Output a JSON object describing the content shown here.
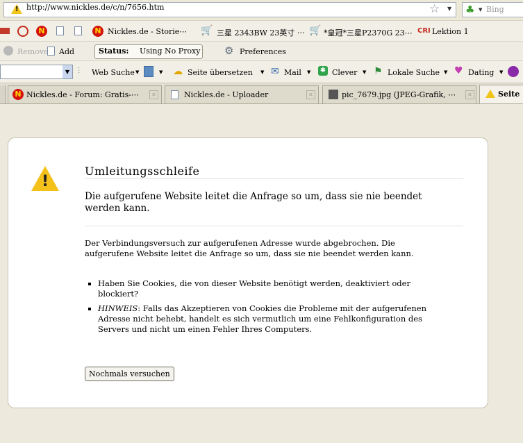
{
  "urlbar": {
    "url": "http://www.nickles.de/c/n/7656.htm",
    "search_placeholder": "Bing"
  },
  "bookmarks": [
    {
      "label": "Nickles.de - Storie⋯"
    },
    {
      "label": "三星 2343BW 23英寸 ⋯"
    },
    {
      "label": "*皇冠*三星P2370G 23⋯"
    },
    {
      "label": "Lektion 1"
    }
  ],
  "addonbar": {
    "remove": "Remove",
    "add": "Add",
    "status_label": "Status:",
    "status_value": "Using No Proxy",
    "preferences": "Preferences"
  },
  "toolbar": {
    "web_search": "Web Suche",
    "translate": "Seite übersetzen",
    "mail": "Mail",
    "clever": "Clever",
    "local_search": "Lokale Suche",
    "dating": "Dating"
  },
  "tabs": [
    {
      "label": "Nickles.de - Forum: Gratis-⋯"
    },
    {
      "label": "Nickles.de - Uploader"
    },
    {
      "label": "pic_7679.jpg (JPEG-Grafik, ⋯"
    },
    {
      "label": "Seite"
    }
  ],
  "error": {
    "title": "Umleitungsschleife",
    "short": "Die aufgerufene Website leitet die Anfrage so um, dass sie nie beendet werden kann.",
    "long": "Der Verbindungsversuch zur aufgerufenen Adresse wurde abgebrochen. Die aufgerufene Website leitet die Anfrage so um, dass sie nie beendet werden kann.",
    "bullet1": "Haben Sie Cookies, die von dieser Website benötigt werden, deaktiviert oder blockiert?",
    "hint_label": "HINWEIS",
    "bullet2": ": Falls das Akzeptieren von Cookies die Probleme mit der aufgerufenen Adresse nicht behebt, handelt es sich vermutlich um eine Fehlkonfiguration des Servers und nicht um einen Fehler Ihres Computers.",
    "button": "Nochmals versuchen"
  }
}
